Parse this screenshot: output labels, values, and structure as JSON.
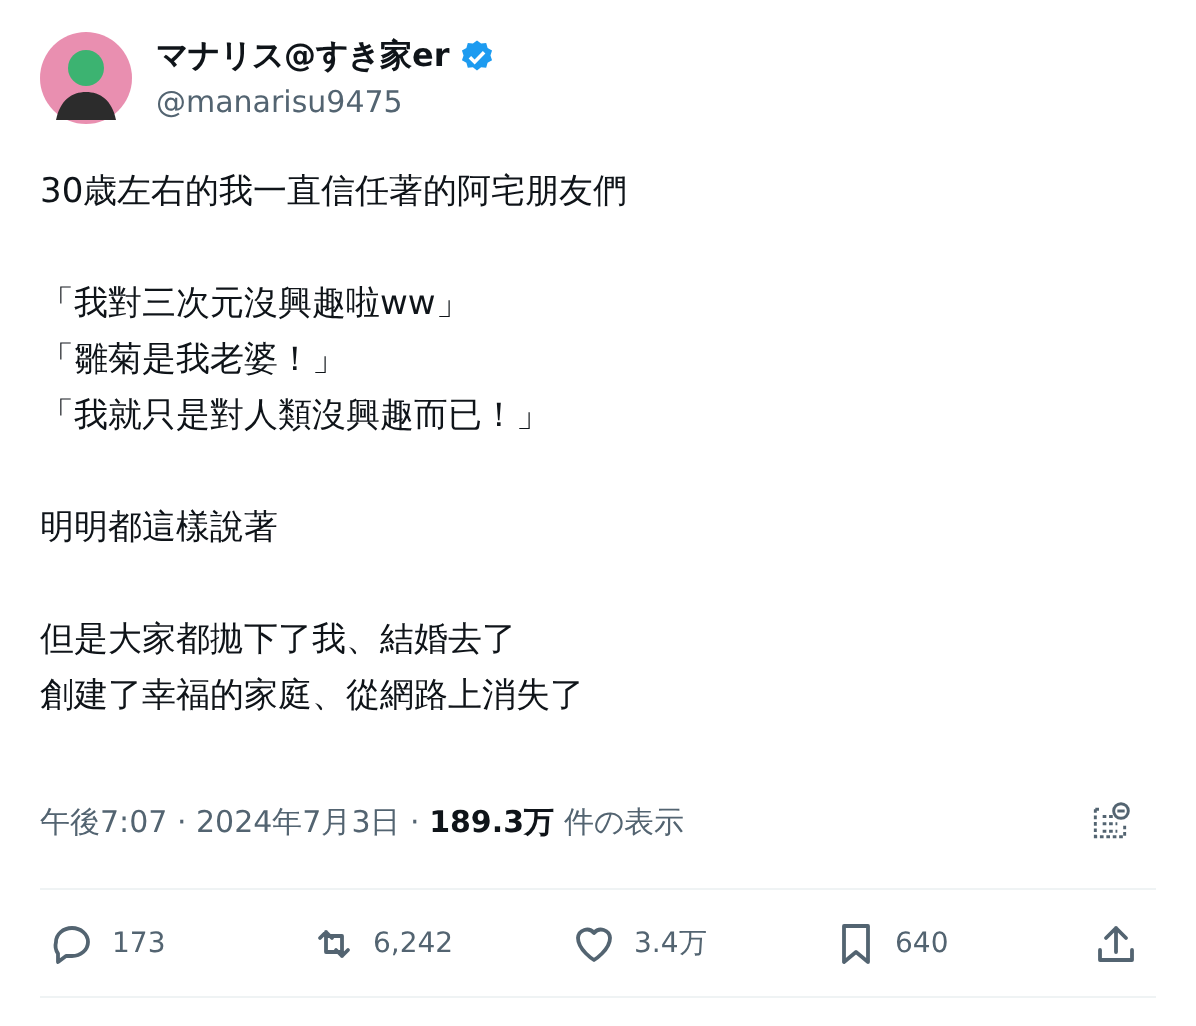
{
  "author": {
    "name": "マナリス@すき家er",
    "verified": true,
    "handle": "@manarisu9475"
  },
  "body": {
    "paragraphs": [
      [
        "30歳左右的我一直信任著的阿宅朋友們"
      ],
      [
        "「我對三次元沒興趣啦ww」",
        "「雛菊是我老婆！」",
        "「我就只是對人類沒興趣而已！」"
      ],
      [
        "明明都這樣說著"
      ],
      [
        "但是大家都拋下了我、結婚去了",
        "創建了幸福的家庭、從網路上消失了"
      ]
    ]
  },
  "meta": "午後7:07 · 2024年7月3日 · **189.3万** 件の表示",
  "actions": [
    {
      "kind": "reply",
      "count": "173"
    },
    {
      "kind": "repost",
      "count": "6,242"
    },
    {
      "kind": "like",
      "count": "3.4万"
    },
    {
      "kind": "bookmark",
      "count": "640"
    },
    {
      "kind": "share"
    }
  ]
}
